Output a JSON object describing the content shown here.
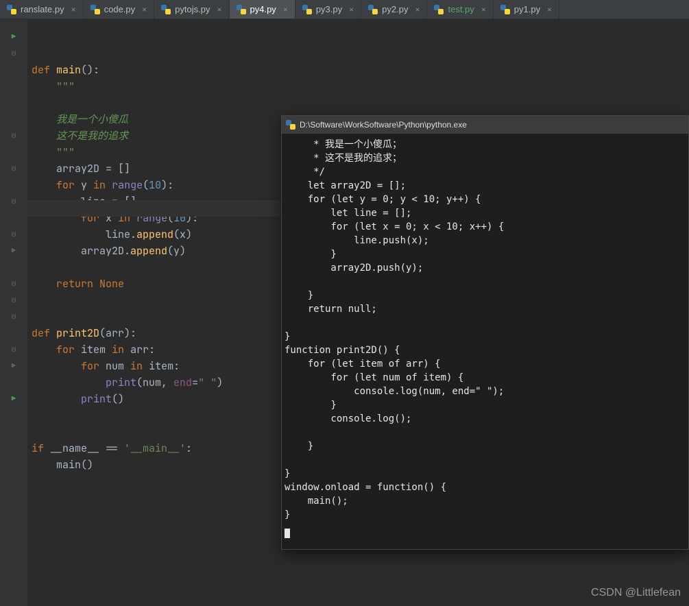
{
  "tabs": [
    {
      "label": "ranslate.py",
      "active": false
    },
    {
      "label": "code.py",
      "active": false
    },
    {
      "label": "pytojs.py",
      "active": false
    },
    {
      "label": "py4.py",
      "active": true
    },
    {
      "label": "py3.py",
      "active": false
    },
    {
      "label": "py2.py",
      "active": false
    },
    {
      "label": "test.py",
      "active": false,
      "test": true
    },
    {
      "label": "py1.py",
      "active": false
    }
  ],
  "code": {
    "l01a": "def ",
    "l01b": "main",
    "l01c": "():",
    "l02": "    \"\"\"",
    "l03": "    我是一个小傻瓜",
    "l04": "    这不是我的追求",
    "l05": "    \"\"\"",
    "l06a": "    array2D = []",
    "l07a": "    ",
    "l07b": "for ",
    "l07c": "y ",
    "l07d": "in ",
    "l07e": "range",
    "l07f": "(",
    "l07g": "10",
    "l07h": "):",
    "l08": "        line = []",
    "l09a": "        ",
    "l09b": "for ",
    "l09c": "x ",
    "l09d": "in ",
    "l09e": "range",
    "l09f": "(",
    "l09g": "10",
    "l09h": "):",
    "l10a": "            line.",
    "l10b": "append",
    "l10c": "(x)",
    "l11a": "        array2D.",
    "l11b": "append",
    "l11c": "(y)",
    "l12": "",
    "l13a": "    ",
    "l13b": "return ",
    "l13c": "None",
    "l14": "",
    "l15": "",
    "l16a": "def ",
    "l16b": "print2D",
    "l16c": "(arr):",
    "l17a": "    ",
    "l17b": "for ",
    "l17c": "item ",
    "l17d": "in ",
    "l17e": "arr:",
    "l18a": "        ",
    "l18b": "for ",
    "l18c": "num ",
    "l18d": "in ",
    "l18e": "item:",
    "l19a": "            ",
    "l19b": "print",
    "l19c": "(num, ",
    "l19d": "end",
    "l19e": "=",
    "l19f": "\" \"",
    "l19g": ")",
    "l20a": "        ",
    "l20b": "print",
    "l20c": "()",
    "l21": "",
    "l22": "",
    "l23a": "if ",
    "l23b": "__name__ == ",
    "l23c": "'__main__'",
    "l23d": ":",
    "l24": "    main()"
  },
  "console": {
    "title": "D:\\Software\\WorkSoftware\\Python\\python.exe",
    "body": "     * 我是一个小傻瓜；\n     * 这不是我的追求；\n     */\n    let array2D = [];\n    for (let y = 0; y < 10; y++) {\n        let line = [];\n        for (let x = 0; x < 10; x++) {\n            line.push(x);\n        }\n        array2D.push(y);\n\n    }\n    return null;\n\n}\nfunction print2D() {\n    for (let item of arr) {\n        for (let num of item) {\n            console.log(num, end=\" \");\n        }\n        console.log();\n\n    }\n\n}\nwindow.onload = function() {\n    main();\n}"
  },
  "watermark": "CSDN @Littlefean"
}
